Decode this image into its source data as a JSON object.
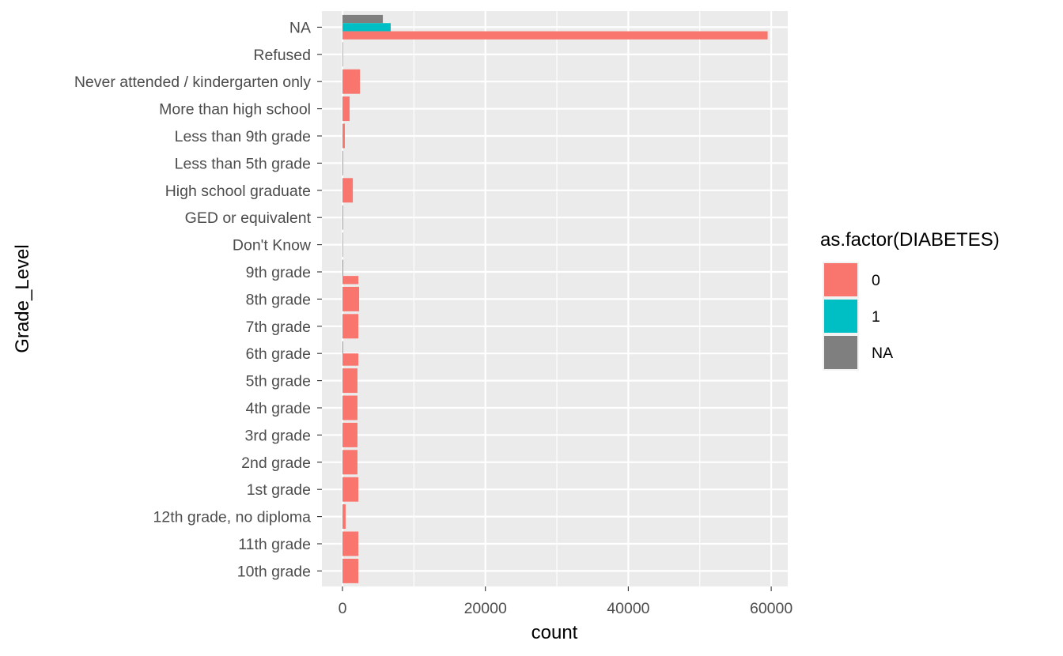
{
  "chart_data": {
    "type": "bar",
    "orientation": "horizontal",
    "position": "dodge",
    "title": "",
    "xlabel": "count",
    "ylabel": "Grade_Level",
    "xlim": [
      -2800,
      62500
    ],
    "x_ticks": [
      0,
      20000,
      40000,
      60000
    ],
    "x_tick_labels": [
      "0",
      "20000",
      "40000",
      "60000"
    ],
    "x_minor_ticks": [
      10000,
      30000,
      50000
    ],
    "grid": true,
    "categories": [
      "NA",
      "Refused",
      "Never attended / kindergarten only",
      "More than high school",
      "Less than 9th grade",
      "Less than 5th grade",
      "High school graduate",
      "GED or equivalent",
      "Don't Know",
      "9th grade",
      "8th grade",
      "7th grade",
      "6th grade",
      "5th grade",
      "4th grade",
      "3rd grade",
      "2nd grade",
      "1st grade",
      "12th grade, no diploma",
      "11th grade",
      "10th grade"
    ],
    "series": [
      {
        "name": "0",
        "color": "#F8766D",
        "values": [
          59500,
          5,
          2450,
          1000,
          330,
          110,
          1450,
          110,
          5,
          2220,
          2330,
          2220,
          2220,
          2100,
          2100,
          2100,
          2100,
          2220,
          440,
          2220,
          2220
        ]
      },
      {
        "name": "1",
        "color": "#00BFC4",
        "values": [
          6750,
          0,
          0,
          0,
          0,
          0,
          0,
          0,
          0,
          100,
          0,
          0,
          100,
          0,
          0,
          0,
          0,
          0,
          0,
          0,
          0
        ]
      },
      {
        "name": "NA",
        "color": "#7F7F7F",
        "values": [
          5650,
          0,
          0,
          0,
          0,
          0,
          0,
          0,
          0,
          100,
          0,
          0,
          0,
          0,
          0,
          0,
          0,
          0,
          0,
          0,
          0
        ]
      }
    ],
    "legend": {
      "title": "as.factor(DIABETES)",
      "position": "right",
      "items": [
        {
          "label": "0",
          "color": "#F8766D"
        },
        {
          "label": "1",
          "color": "#00BFC4"
        },
        {
          "label": "NA",
          "color": "#7F7F7F"
        }
      ]
    }
  },
  "colors": {
    "panel_background": "#EBEBEB",
    "grid": "#FFFFFF",
    "tick_text": "#4D4D4D",
    "tick_mark": "#333333"
  }
}
